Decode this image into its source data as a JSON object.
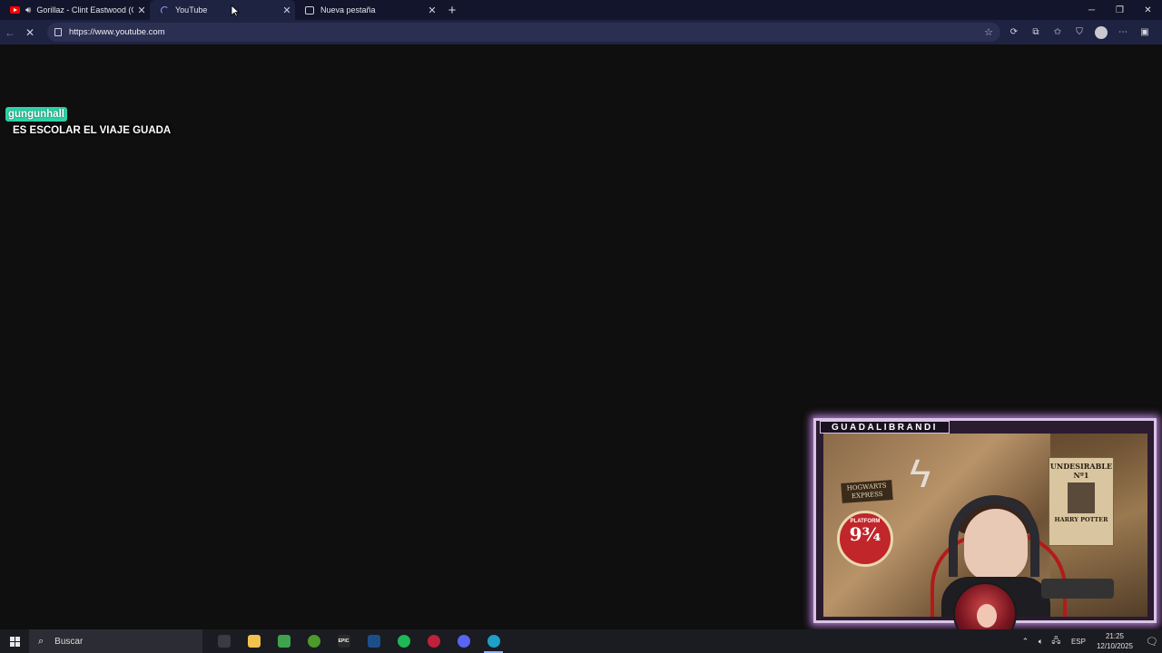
{
  "browser": {
    "tabs": [
      {
        "label": "Gorillaz - Clint Eastwood (Of",
        "favicon": "youtube-icon",
        "audio": true
      },
      {
        "label": "YouTube",
        "favicon": "loading-spinner",
        "active": true
      },
      {
        "label": "Nueva pestaña",
        "favicon": "new-tab-icon"
      }
    ],
    "close_glyph": "✕",
    "new_tab_glyph": "+",
    "url": "https://www.youtube.com"
  },
  "stream": {
    "chat": {
      "username": "gungunhall",
      "message": "ES ESCOLAR EL VIAJE GUADA"
    },
    "webcam": {
      "channel_name": "GUADALIBRANDI",
      "frame_color": "#d9c4e6"
    },
    "scene_text": {
      "hogwarts_sign": "HOGWARTS EXPRESS",
      "platform_label": "PLATFORM",
      "platform_number": "9¾",
      "poster_line1": "UNDESIRABLE",
      "poster_line2": "Nº1",
      "poster_line3": "HARRY POTTER"
    }
  },
  "taskbar": {
    "search_placeholder": "Buscar",
    "apps": [
      {
        "name": "taskbar-app-blank",
        "color": "#3a3a44",
        "glyph": ""
      },
      {
        "name": "file-explorer-icon",
        "color": "#f2c14e",
        "glyph": ""
      },
      {
        "name": "xbox-gamebar-icon",
        "color": "#3fa34d",
        "glyph": ""
      },
      {
        "name": "xbox-icon",
        "color": "#4c9a2a",
        "glyph": ""
      },
      {
        "name": "epic-games-icon",
        "color": "#2a2a2a",
        "glyph": "EPIC"
      },
      {
        "name": "steam-icon",
        "color": "#1b4f8a",
        "glyph": ""
      },
      {
        "name": "spotify-icon",
        "color": "#1db954",
        "glyph": ""
      },
      {
        "name": "obs-icon",
        "color": "#c0203a",
        "glyph": ""
      },
      {
        "name": "discord-icon",
        "color": "#5865f2",
        "glyph": ""
      },
      {
        "name": "edge-icon",
        "color": "#1fa0c8",
        "glyph": "",
        "active": true
      }
    ],
    "language": "ESP",
    "time": "21:25",
    "date": "12/10/2025"
  }
}
